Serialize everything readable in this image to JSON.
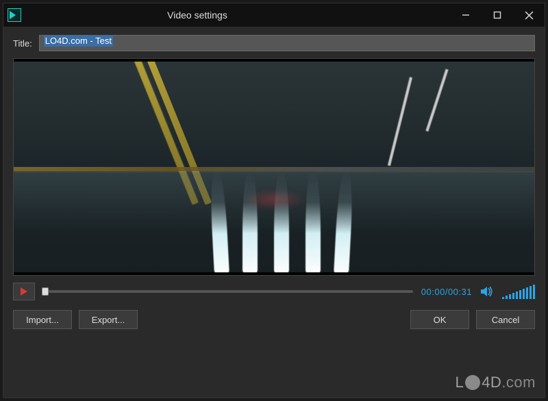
{
  "window": {
    "title": "Video settings"
  },
  "titleField": {
    "label": "Title:",
    "value": "LO4D.com - Test"
  },
  "playback": {
    "current": "00:00",
    "total": "00:31",
    "separator": "/",
    "position_percent": 0,
    "volume_level": 10
  },
  "buttons": {
    "import": "Import...",
    "export": "Export...",
    "ok": "OK",
    "cancel": "Cancel"
  },
  "watermark": "LO4D.com",
  "colors": {
    "accent": "#2aa5e8",
    "play": "#e03535"
  }
}
